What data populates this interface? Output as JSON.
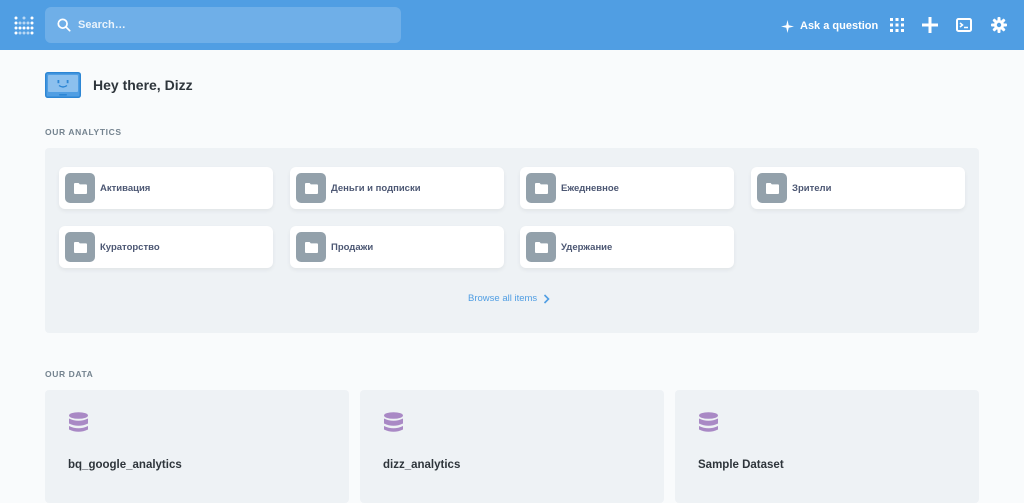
{
  "search": {
    "placeholder": "Search…"
  },
  "nav": {
    "ask_label": "Ask a question"
  },
  "greeting": {
    "title": "Hey there, Dizz"
  },
  "analytics": {
    "section_label": "OUR ANALYTICS",
    "collections": [
      {
        "name": "Активация"
      },
      {
        "name": "Деньги и подписки"
      },
      {
        "name": "Ежедневное"
      },
      {
        "name": "Зрители"
      },
      {
        "name": "Кураторство"
      },
      {
        "name": "Продажи"
      },
      {
        "name": "Удержание"
      }
    ],
    "browse_label": "Browse all items"
  },
  "data": {
    "section_label": "OUR DATA",
    "databases": [
      {
        "name": "bq_google_analytics"
      },
      {
        "name": "dizz_analytics"
      },
      {
        "name": "Sample Dataset"
      }
    ]
  },
  "colors": {
    "brand": "#509ee3",
    "database_icon": "#a989c5",
    "folder_icon_bg": "#93a1ab",
    "panel_bg": "#eef2f5"
  }
}
